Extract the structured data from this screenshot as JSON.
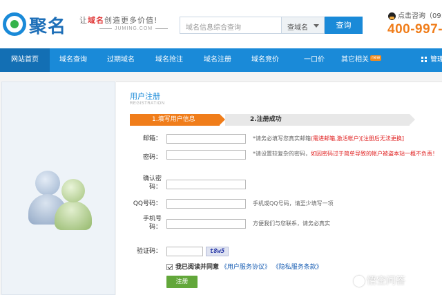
{
  "header": {
    "logo_text": "聚名",
    "slogan_prefix": "让",
    "slogan_highlight": "域名",
    "slogan_suffix": "创造更多价值!",
    "slogan_sub": "JUMING.COM",
    "search_placeholder": "域名信息综合查询",
    "search_type": "查域名",
    "search_button": "查询",
    "contact_label": "点击咨询（09:",
    "phone": "400-997-"
  },
  "nav": {
    "items": [
      {
        "label": "网站首页",
        "active": true
      },
      {
        "label": "域名查询"
      },
      {
        "label": "过期域名"
      },
      {
        "label": "域名抢注"
      },
      {
        "label": "域名注册"
      },
      {
        "label": "域名竞价"
      },
      {
        "label": "一口价"
      },
      {
        "label": "其它相关",
        "badge": "new"
      },
      {
        "label": "管理"
      }
    ]
  },
  "form": {
    "title": "用户注册",
    "subtitle": "REGISTRATION",
    "step1": "1.填写用户信息",
    "step2": "2.注册成功",
    "email_label": "邮箱：",
    "email_hint_prefix": "*请务必填写您真实邮箱",
    "email_hint_red": "(需进邮箱,激活帐户)[注册后无法更换]",
    "password_label": "密码：",
    "password_hint_prefix": "*请设置较复杂的密码，",
    "password_hint_red": "如因密码过于简单导致的帐户被盗本站一概不负责！",
    "confirm_label_line1": "确认密",
    "confirm_label_line2": "码：",
    "qq_label": "QQ号码：",
    "qq_hint": "手机或QQ号码，请至少填写一项",
    "mobile_label_line1": "手机号",
    "mobile_label_line2": "码：",
    "mobile_hint": "方便我们与您联系，请务必真实",
    "captcha_label": "验证码：",
    "captcha_text": "t8w5",
    "agree_text": "我已阅读并同意",
    "agree_link1": "《用户服务协议》",
    "agree_link2": "《隐私服务条款》",
    "submit_label": "注册"
  },
  "watermark": "悟空问答"
}
